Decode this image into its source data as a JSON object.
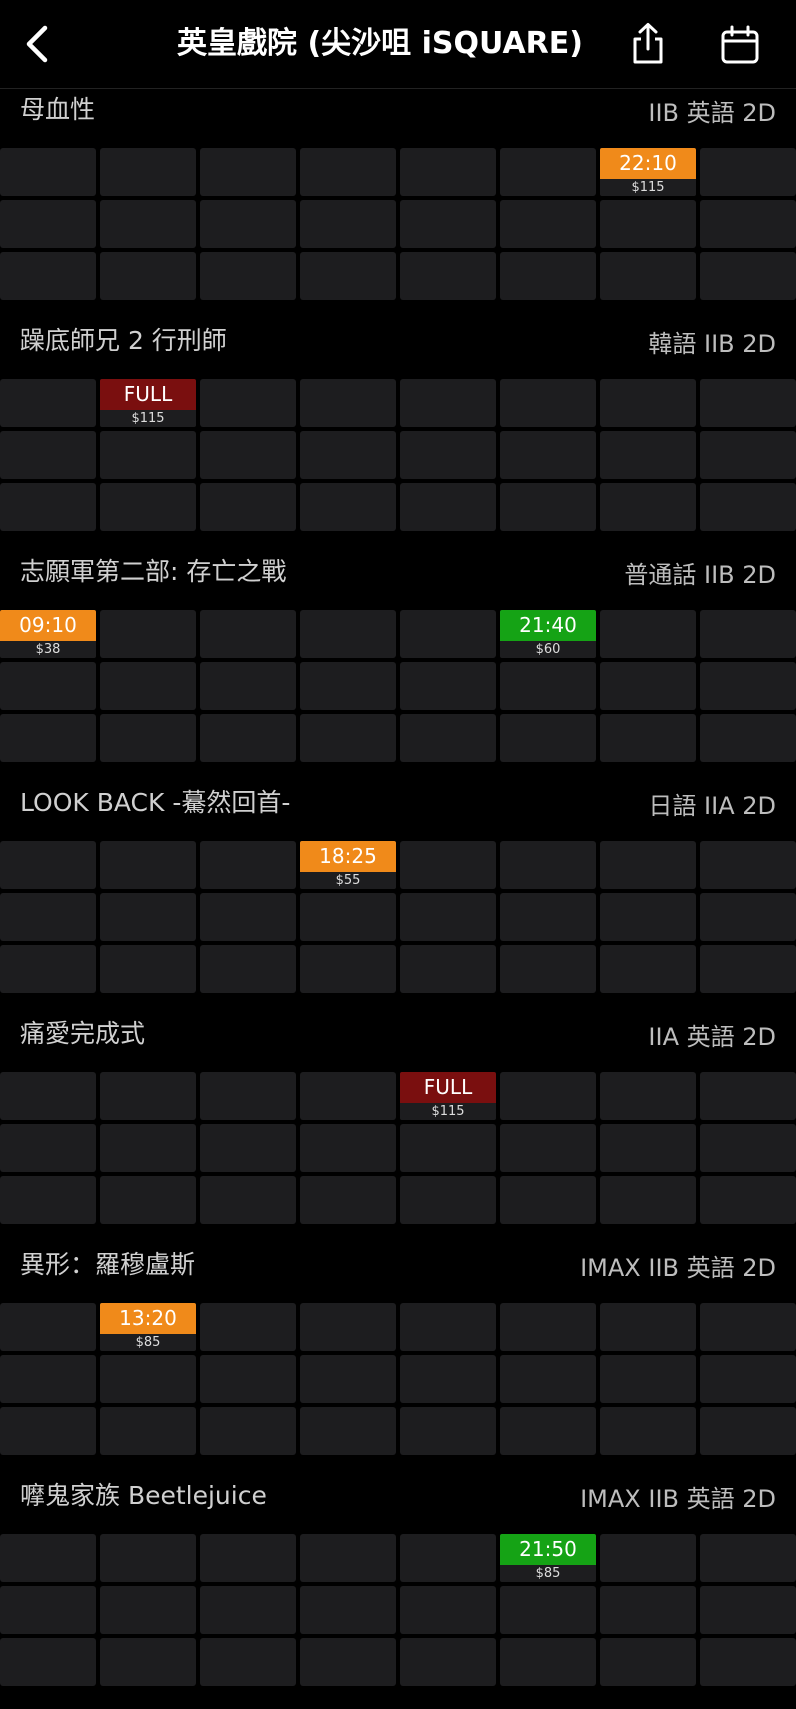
{
  "header": {
    "title": "英皇戲院 (尖沙咀 iSQUARE)"
  },
  "colors": {
    "background": "#000000",
    "empty_cell": "#1d1d1f",
    "orange": "#f08a1a",
    "green": "#15a315",
    "full_red": "#7a0f0f"
  },
  "movies": [
    {
      "title": "母血性",
      "meta": "IIB 英語 2D",
      "sessions": [
        {
          "row": 0,
          "col": 6,
          "time": "22:10",
          "price": "$115",
          "status": "orange"
        }
      ]
    },
    {
      "title": "躁底師兄 2 行刑師",
      "meta": "韓語 IIB 2D",
      "sessions": [
        {
          "row": 0,
          "col": 1,
          "time": "FULL",
          "price": "$115",
          "status": "full"
        }
      ]
    },
    {
      "title": "志願軍第二部: 存亡之戰",
      "meta": "普通話 IIB 2D",
      "sessions": [
        {
          "row": 0,
          "col": 0,
          "time": "09:10",
          "price": "$38",
          "status": "orange"
        },
        {
          "row": 0,
          "col": 5,
          "time": "21:40",
          "price": "$60",
          "status": "green"
        }
      ]
    },
    {
      "title": "LOOK BACK -驀然回首-",
      "meta": "日語 IIA 2D",
      "sessions": [
        {
          "row": 0,
          "col": 3,
          "time": "18:25",
          "price": "$55",
          "status": "orange"
        }
      ]
    },
    {
      "title": "痛愛完成式",
      "meta": "IIA 英語 2D",
      "sessions": [
        {
          "row": 0,
          "col": 4,
          "time": "FULL",
          "price": "$115",
          "status": "full"
        }
      ]
    },
    {
      "title": "異形：羅穆盧斯",
      "meta": "IMAX IIB 英語 2D",
      "sessions": [
        {
          "row": 0,
          "col": 1,
          "time": "13:20",
          "price": "$85",
          "status": "orange"
        }
      ]
    },
    {
      "title": "嚤鬼家族 Beetlejuice",
      "meta": "IMAX IIB 英語 2D",
      "sessions": [
        {
          "row": 0,
          "col": 5,
          "time": "21:50",
          "price": "$85",
          "status": "green"
        }
      ]
    }
  ]
}
